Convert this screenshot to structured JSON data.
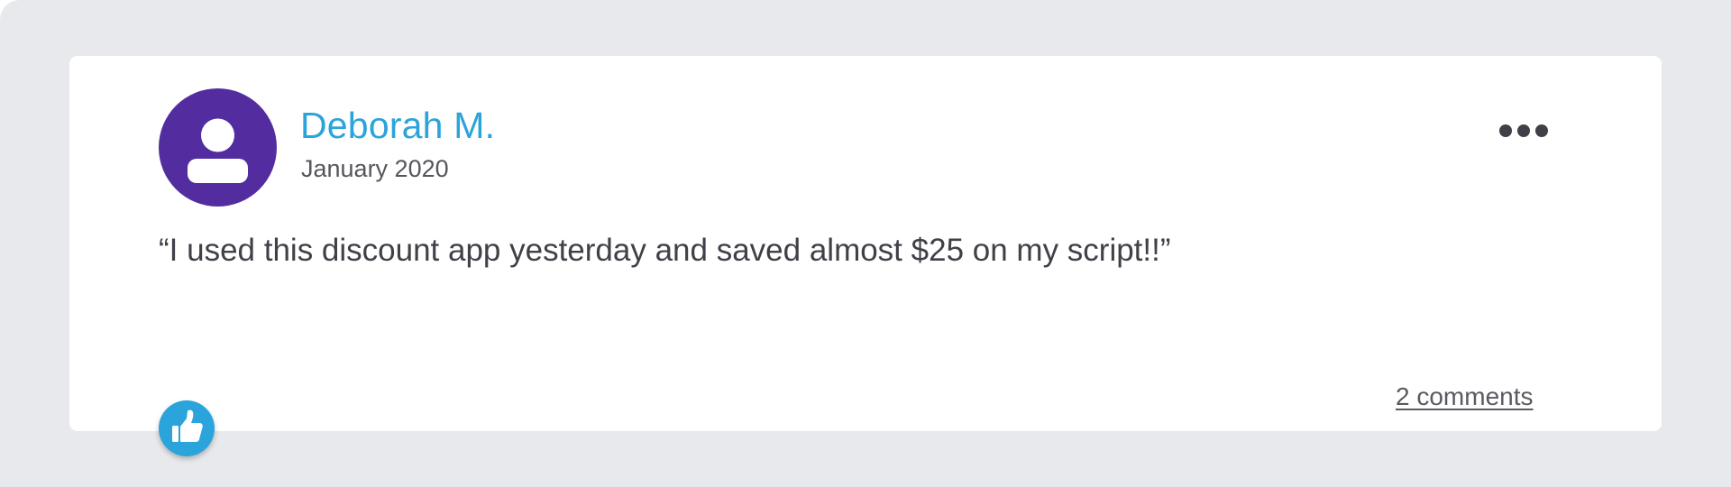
{
  "post": {
    "author_name": "Deborah M.",
    "date": "January 2020",
    "quote": "“I used this discount app yesterday and saved almost $25 on my script!!”",
    "comments_label": "2 comments"
  },
  "icons": {
    "avatar": "user-icon",
    "more": "more-horizontal-icon",
    "like": "thumbs-up-icon"
  },
  "colors": {
    "background": "#e8e9ec",
    "card": "#ffffff",
    "avatar": "#532da0",
    "author_name": "#2aa4db",
    "like_button": "#2aa4db",
    "text": "#404148"
  }
}
